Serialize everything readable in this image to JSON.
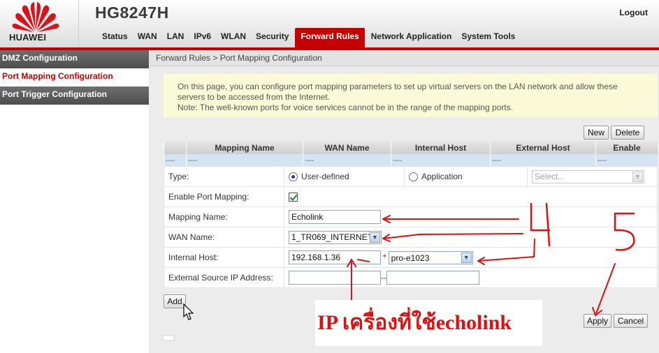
{
  "header": {
    "brand": "HUAWEI",
    "product": "HG8247H",
    "logout": "Logout",
    "brand_color": "#c40000"
  },
  "nav": {
    "tabs": [
      {
        "label": "Status"
      },
      {
        "label": "WAN"
      },
      {
        "label": "LAN"
      },
      {
        "label": "IPv6"
      },
      {
        "label": "WLAN"
      },
      {
        "label": "Security"
      },
      {
        "label": "Forward Rules",
        "active": true
      },
      {
        "label": "Network Application"
      },
      {
        "label": "System Tools"
      }
    ]
  },
  "sidebar": {
    "items": [
      {
        "label": "DMZ Configuration"
      },
      {
        "label": "Port Mapping Configuration",
        "active": true
      },
      {
        "label": "Port Trigger Configuration"
      }
    ]
  },
  "breadcrumb": "Forward Rules > Port Mapping Configuration",
  "notice": {
    "line1": "On this page, you can configure port mapping parameters to set up virtual servers on the LAN network and allow these servers to be accessed from the Internet.",
    "line2": "Note: The well-known ports for voice services cannot be in the range of the mapping ports."
  },
  "table": {
    "new_label": "New",
    "delete_label": "Delete",
    "headers": [
      "",
      "Mapping Name",
      "WAN Name",
      "Internal Host",
      "External Host",
      "Enable"
    ],
    "row": [
      "----",
      "----",
      "----",
      "----",
      "----",
      "----"
    ]
  },
  "form": {
    "type_label": "Type:",
    "type_user_defined": "User-defined",
    "type_application": "Application",
    "app_select_placeholder": "Select...",
    "enable_label": "Enable Port Mapping:",
    "enable_checked": true,
    "mapping_name_label": "Mapping Name:",
    "mapping_name_value": "Echolink",
    "wan_name_label": "WAN Name:",
    "wan_name_value": "1_TR069_INTERNET",
    "internal_host_label": "Internal Host:",
    "internal_host_value": "192.168.1.36",
    "internal_host_select": "pro-e1023",
    "ext_src_label": "External Source IP Address:",
    "ext_src_start": "",
    "ext_src_end": "",
    "range_sep": "--",
    "required_mark": "*"
  },
  "buttons": {
    "add": "Add",
    "apply": "Apply",
    "cancel": "Cancel"
  },
  "annotation": {
    "caption": "IP เครื่องที่ใช้echolink",
    "step_4": "4",
    "step_5": "5",
    "color": "#e01010"
  }
}
